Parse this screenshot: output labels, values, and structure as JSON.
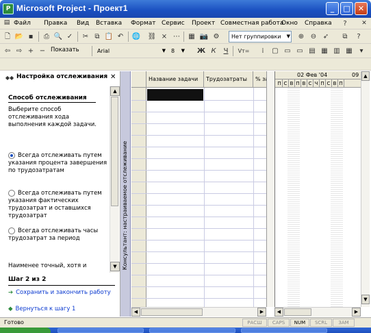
{
  "window": {
    "title": "Microsoft Project - Проект1",
    "minimize": "_",
    "maximize": "□",
    "close": "✕"
  },
  "menu": [
    {
      "label": "Файл"
    },
    {
      "label": "Правка"
    },
    {
      "label": "Вид"
    },
    {
      "label": "Вставка"
    },
    {
      "label": "Формат"
    },
    {
      "label": "Сервис"
    },
    {
      "label": "Проект"
    },
    {
      "label": "Совместная работа"
    },
    {
      "label": "Окно"
    },
    {
      "label": "Справка"
    }
  ],
  "toolbar": {
    "grouping_value": "Нет группировки",
    "show_label": "Показать",
    "font_value": "Arial",
    "font_size_value": "8",
    "bold_label": "Ж",
    "italic_label": "К",
    "underline_label": "Ч",
    "filter_label": "Vт="
  },
  "side_pane": {
    "title": "Настройка отслеживания",
    "section_title": "Способ отслеживания",
    "description": "Выберите способ отслеживания хода выполнения каждой задачи.",
    "options": [
      {
        "label": "Всегда отслеживать путем указания процента завершения по трудозатратам",
        "selected": true
      },
      {
        "label": "Всегда отслеживать путем указания фактических трудозатрат и оставшихся трудозатрат",
        "selected": false
      },
      {
        "label": "Всегда отслеживать часы трудозатрат за период",
        "selected": false
      }
    ],
    "footer_note": "Наименее точный, хотя и",
    "step_label": "Шаг 2 из 2",
    "save_link": "Сохранить и закончить работу",
    "back_link": "Вернуться к шагу 1"
  },
  "consultant_bar": {
    "label": "Консультант: настраиваемое отслеживание"
  },
  "table": {
    "columns": [
      "Название задачи",
      "Трудозатраты",
      "% зат"
    ]
  },
  "gantt": {
    "week_label": "02 Фев '04",
    "next_week_label": "09",
    "days": [
      "П",
      "С",
      "В",
      "П",
      "В",
      "С",
      "Ч",
      "П",
      "С",
      "В",
      "П"
    ]
  },
  "status": {
    "text": "Готово",
    "indicators": [
      {
        "label": "РАСШ",
        "active": false
      },
      {
        "label": "CAPS",
        "active": false
      },
      {
        "label": "NUM",
        "active": true
      },
      {
        "label": "SCRL",
        "active": false
      },
      {
        "label": "ЗАМ",
        "active": false
      }
    ]
  }
}
